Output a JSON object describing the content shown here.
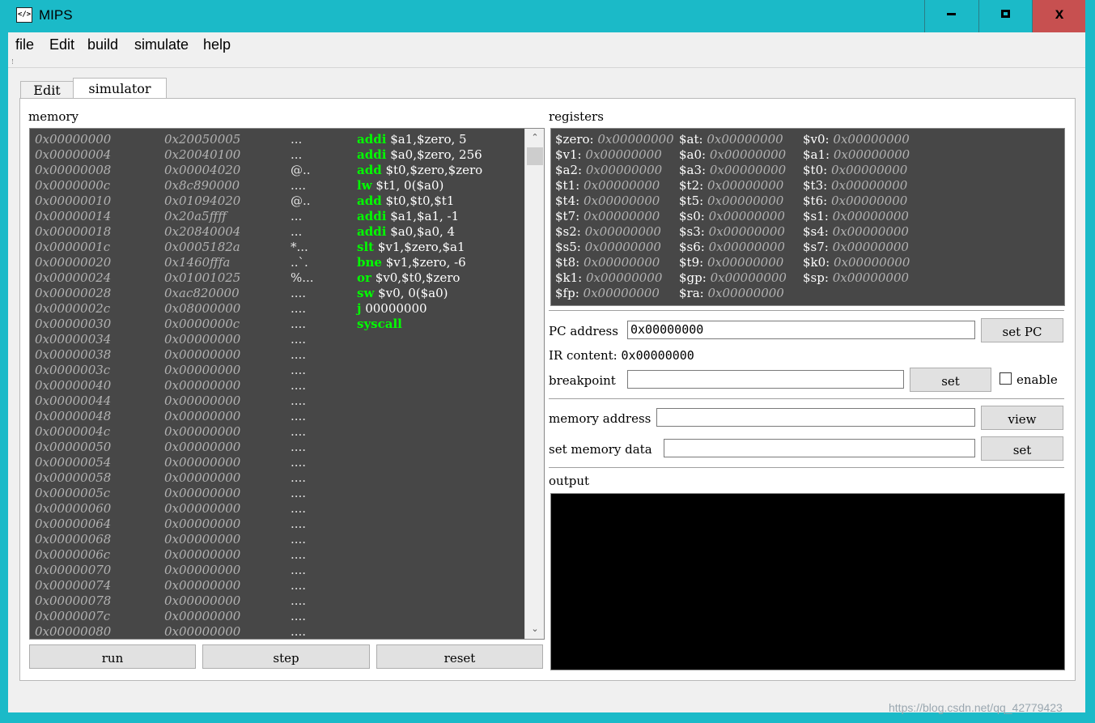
{
  "window": {
    "title": "MIPS",
    "app_icon": "</>",
    "minimize_glyph": "▁",
    "maximize_glyph": "■",
    "close_glyph": "x"
  },
  "menu": [
    "file",
    "Edit",
    "build",
    "simulate",
    "help"
  ],
  "tabs": {
    "edit": "Edit",
    "simulator": "simulator"
  },
  "memory": {
    "label": "memory",
    "rows": [
      {
        "addr": "0x00000000",
        "word": "0x20050005",
        "ascii": "...",
        "op": "addi",
        "args": "$a1,$zero, 5"
      },
      {
        "addr": "0x00000004",
        "word": "0x20040100",
        "ascii": "...",
        "op": "addi",
        "args": "$a0,$zero, 256"
      },
      {
        "addr": "0x00000008",
        "word": "0x00004020",
        "ascii": "@..",
        "op": "add",
        "args": "$t0,$zero,$zero"
      },
      {
        "addr": "0x0000000c",
        "word": "0x8c890000",
        "ascii": "....",
        "op": "lw",
        "args": "$t1, 0($a0)"
      },
      {
        "addr": "0x00000010",
        "word": "0x01094020",
        "ascii": "@..",
        "op": "add",
        "args": "$t0,$t0,$t1"
      },
      {
        "addr": "0x00000014",
        "word": "0x20a5ffff",
        "ascii": "...",
        "op": "addi",
        "args": "$a1,$a1, -1"
      },
      {
        "addr": "0x00000018",
        "word": "0x20840004",
        "ascii": "...",
        "op": "addi",
        "args": "$a0,$a0, 4"
      },
      {
        "addr": "0x0000001c",
        "word": "0x0005182a",
        "ascii": "*...",
        "op": "slt",
        "args": "$v1,$zero,$a1"
      },
      {
        "addr": "0x00000020",
        "word": "0x1460fffa",
        "ascii": "..`.",
        "op": "bne",
        "args": "$v1,$zero, -6"
      },
      {
        "addr": "0x00000024",
        "word": "0x01001025",
        "ascii": "%...",
        "op": "or",
        "args": "$v0,$t0,$zero"
      },
      {
        "addr": "0x00000028",
        "word": "0xac820000",
        "ascii": "....",
        "op": "sw",
        "args": "$v0, 0($a0)"
      },
      {
        "addr": "0x0000002c",
        "word": "0x08000000",
        "ascii": "....",
        "op": "j",
        "args": "00000000"
      },
      {
        "addr": "0x00000030",
        "word": "0x0000000c",
        "ascii": "....",
        "op": "syscall",
        "args": ""
      },
      {
        "addr": "0x00000034",
        "word": "0x00000000",
        "ascii": "....",
        "op": "",
        "args": ""
      },
      {
        "addr": "0x00000038",
        "word": "0x00000000",
        "ascii": "....",
        "op": "",
        "args": ""
      },
      {
        "addr": "0x0000003c",
        "word": "0x00000000",
        "ascii": "....",
        "op": "",
        "args": ""
      },
      {
        "addr": "0x00000040",
        "word": "0x00000000",
        "ascii": "....",
        "op": "",
        "args": ""
      },
      {
        "addr": "0x00000044",
        "word": "0x00000000",
        "ascii": "....",
        "op": "",
        "args": ""
      },
      {
        "addr": "0x00000048",
        "word": "0x00000000",
        "ascii": "....",
        "op": "",
        "args": ""
      },
      {
        "addr": "0x0000004c",
        "word": "0x00000000",
        "ascii": "....",
        "op": "",
        "args": ""
      },
      {
        "addr": "0x00000050",
        "word": "0x00000000",
        "ascii": "....",
        "op": "",
        "args": ""
      },
      {
        "addr": "0x00000054",
        "word": "0x00000000",
        "ascii": "....",
        "op": "",
        "args": ""
      },
      {
        "addr": "0x00000058",
        "word": "0x00000000",
        "ascii": "....",
        "op": "",
        "args": ""
      },
      {
        "addr": "0x0000005c",
        "word": "0x00000000",
        "ascii": "....",
        "op": "",
        "args": ""
      },
      {
        "addr": "0x00000060",
        "word": "0x00000000",
        "ascii": "....",
        "op": "",
        "args": ""
      },
      {
        "addr": "0x00000064",
        "word": "0x00000000",
        "ascii": "....",
        "op": "",
        "args": ""
      },
      {
        "addr": "0x00000068",
        "word": "0x00000000",
        "ascii": "....",
        "op": "",
        "args": ""
      },
      {
        "addr": "0x0000006c",
        "word": "0x00000000",
        "ascii": "....",
        "op": "",
        "args": ""
      },
      {
        "addr": "0x00000070",
        "word": "0x00000000",
        "ascii": "....",
        "op": "",
        "args": ""
      },
      {
        "addr": "0x00000074",
        "word": "0x00000000",
        "ascii": "....",
        "op": "",
        "args": ""
      },
      {
        "addr": "0x00000078",
        "word": "0x00000000",
        "ascii": "....",
        "op": "",
        "args": ""
      },
      {
        "addr": "0x0000007c",
        "word": "0x00000000",
        "ascii": "....",
        "op": "",
        "args": ""
      },
      {
        "addr": "0x00000080",
        "word": "0x00000000",
        "ascii": "....",
        "op": "",
        "args": ""
      }
    ],
    "scroll_up_glyph": "⌃",
    "scroll_down_glyph": "⌄"
  },
  "controls": {
    "run": "run",
    "step": "step",
    "reset": "reset"
  },
  "registers": {
    "label": "registers",
    "rows": [
      [
        {
          "name": "$zero:",
          "value": "0x00000000"
        },
        {
          "name": "$at:",
          "value": "0x00000000"
        },
        {
          "name": "$v0:",
          "value": "0x00000000"
        }
      ],
      [
        {
          "name": "$v1:",
          "value": "0x00000000"
        },
        {
          "name": "$a0:",
          "value": "0x00000000"
        },
        {
          "name": "$a1:",
          "value": "0x00000000"
        }
      ],
      [
        {
          "name": "$a2:",
          "value": "0x00000000"
        },
        {
          "name": "$a3:",
          "value": "0x00000000"
        },
        {
          "name": "$t0:",
          "value": "0x00000000"
        }
      ],
      [
        {
          "name": "$t1:",
          "value": "0x00000000"
        },
        {
          "name": "$t2:",
          "value": "0x00000000"
        },
        {
          "name": "$t3:",
          "value": "0x00000000"
        }
      ],
      [
        {
          "name": "$t4:",
          "value": "0x00000000"
        },
        {
          "name": "$t5:",
          "value": "0x00000000"
        },
        {
          "name": "$t6:",
          "value": "0x00000000"
        }
      ],
      [
        {
          "name": "$t7:",
          "value": "0x00000000"
        },
        {
          "name": "$s0:",
          "value": "0x00000000"
        },
        {
          "name": "$s1:",
          "value": "0x00000000"
        }
      ],
      [
        {
          "name": "$s2:",
          "value": "0x00000000"
        },
        {
          "name": "$s3:",
          "value": "0x00000000"
        },
        {
          "name": "$s4:",
          "value": "0x00000000"
        }
      ],
      [
        {
          "name": "$s5:",
          "value": "0x00000000"
        },
        {
          "name": "$s6:",
          "value": "0x00000000"
        },
        {
          "name": "$s7:",
          "value": "0x00000000"
        }
      ],
      [
        {
          "name": "$t8:",
          "value": "0x00000000"
        },
        {
          "name": "$t9:",
          "value": "0x00000000"
        },
        {
          "name": "$k0:",
          "value": "0x00000000"
        }
      ],
      [
        {
          "name": "$k1:",
          "value": "0x00000000"
        },
        {
          "name": "$gp:",
          "value": "0x00000000"
        },
        {
          "name": "$sp:",
          "value": "0x00000000"
        }
      ],
      [
        {
          "name": "$fp:",
          "value": "0x00000000"
        },
        {
          "name": "$ra:",
          "value": "0x00000000"
        }
      ]
    ]
  },
  "pc": {
    "label": "PC address",
    "value": "0x00000000",
    "button": "set PC"
  },
  "ir": {
    "label": "IR content:",
    "value": "0x00000000"
  },
  "breakpoint": {
    "label": "breakpoint",
    "value": "",
    "button": "set",
    "enable_label": "enable"
  },
  "memory_view": {
    "label": "memory address",
    "value": "",
    "button": "view"
  },
  "memory_set": {
    "label": "set memory data",
    "value": "",
    "button": "set"
  },
  "output": {
    "label": "output",
    "text": ""
  },
  "watermark": "https://blog.csdn.net/qq_42779423"
}
